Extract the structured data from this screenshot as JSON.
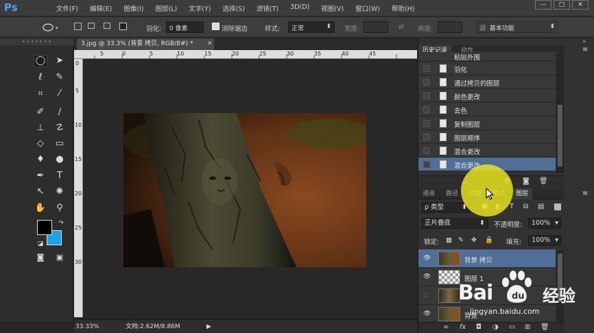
{
  "app": {
    "logo": "Ps"
  },
  "menu": [
    "文件(F)",
    "编辑(E)",
    "图像(I)",
    "图层(L)",
    "文字(Y)",
    "选择(S)",
    "滤镜(T)",
    "3D(D)",
    "视图(V)",
    "窗口(W)",
    "帮助(H)"
  ],
  "window_controls": {
    "minimize": "—",
    "maximize": "□",
    "close": "✕"
  },
  "options": {
    "feather_label": "羽化:",
    "feather_value": "0 像素",
    "antialias_label": "消除锯齿",
    "style_label": "样式:",
    "style_value": "正常",
    "width_label": "宽度:",
    "height_label": "高度:",
    "workspace_value": "基本功能",
    "workspace_prefix": "调",
    "marquee_drop": "▾"
  },
  "document": {
    "tab_title": "3.jpg @ 33.3% (背景 拷贝, RGB/8#) *",
    "close": "✕",
    "ruler_top": [
      "5",
      "0",
      "5",
      "10",
      "15",
      "20",
      "25",
      "30",
      "35",
      "40",
      "45"
    ],
    "ruler_left": [
      "0",
      "5",
      "10",
      "15",
      "20",
      "25",
      "30"
    ]
  },
  "status": {
    "zoom": "33.33%",
    "doc_info": "文档:2.62M/8.86M",
    "arrow": "▶"
  },
  "history": {
    "tabs": [
      "历史记录",
      "动作"
    ],
    "items": [
      {
        "label": "粘贴外围"
      },
      {
        "label": "羽化"
      },
      {
        "label": "通过拷贝的图层"
      },
      {
        "label": "颜色更改"
      },
      {
        "label": "去色"
      },
      {
        "label": "复制图层"
      },
      {
        "label": "图层顺序"
      },
      {
        "label": "混合更改"
      },
      {
        "label": "混合更改"
      }
    ],
    "footer_icons": {
      "new_doc": "⊞",
      "camera": "◙",
      "trash": "🗑"
    }
  },
  "layers_panel": {
    "tabs": [
      "通道",
      "路径",
      "调整",
      "样式",
      "图层"
    ],
    "filter_label": "ρ 类型",
    "blend_mode": "正片叠底",
    "opacity_label": "不透明度:",
    "opacity_value": "100%",
    "lock_label": "锁定:",
    "fill_label": "填充:",
    "fill_value": "100%",
    "layers": [
      {
        "name": "背景 拷贝",
        "visible": true,
        "selected": true
      },
      {
        "name": "图层 1",
        "visible": true,
        "selected": false
      },
      {
        "name": "",
        "visible": false,
        "selected": false
      },
      {
        "name": "背景",
        "visible": true,
        "selected": false
      }
    ],
    "footer": {
      "link": "∞",
      "fx": "fx",
      "mask": "◘",
      "adjust": "◑",
      "group": "▭",
      "new": "⊞",
      "trash": "🗑"
    },
    "panel_menu": "≡",
    "collapse": "»"
  },
  "watermark": {
    "brand": "Bai",
    "brand2": "du",
    "brand_cn": "经验",
    "url": "jingyan.baidu.com"
  },
  "colors": {
    "foreground": "#000000",
    "background": "#1aa3e6",
    "selection": "#516f96",
    "highlight": "#ece81e"
  }
}
